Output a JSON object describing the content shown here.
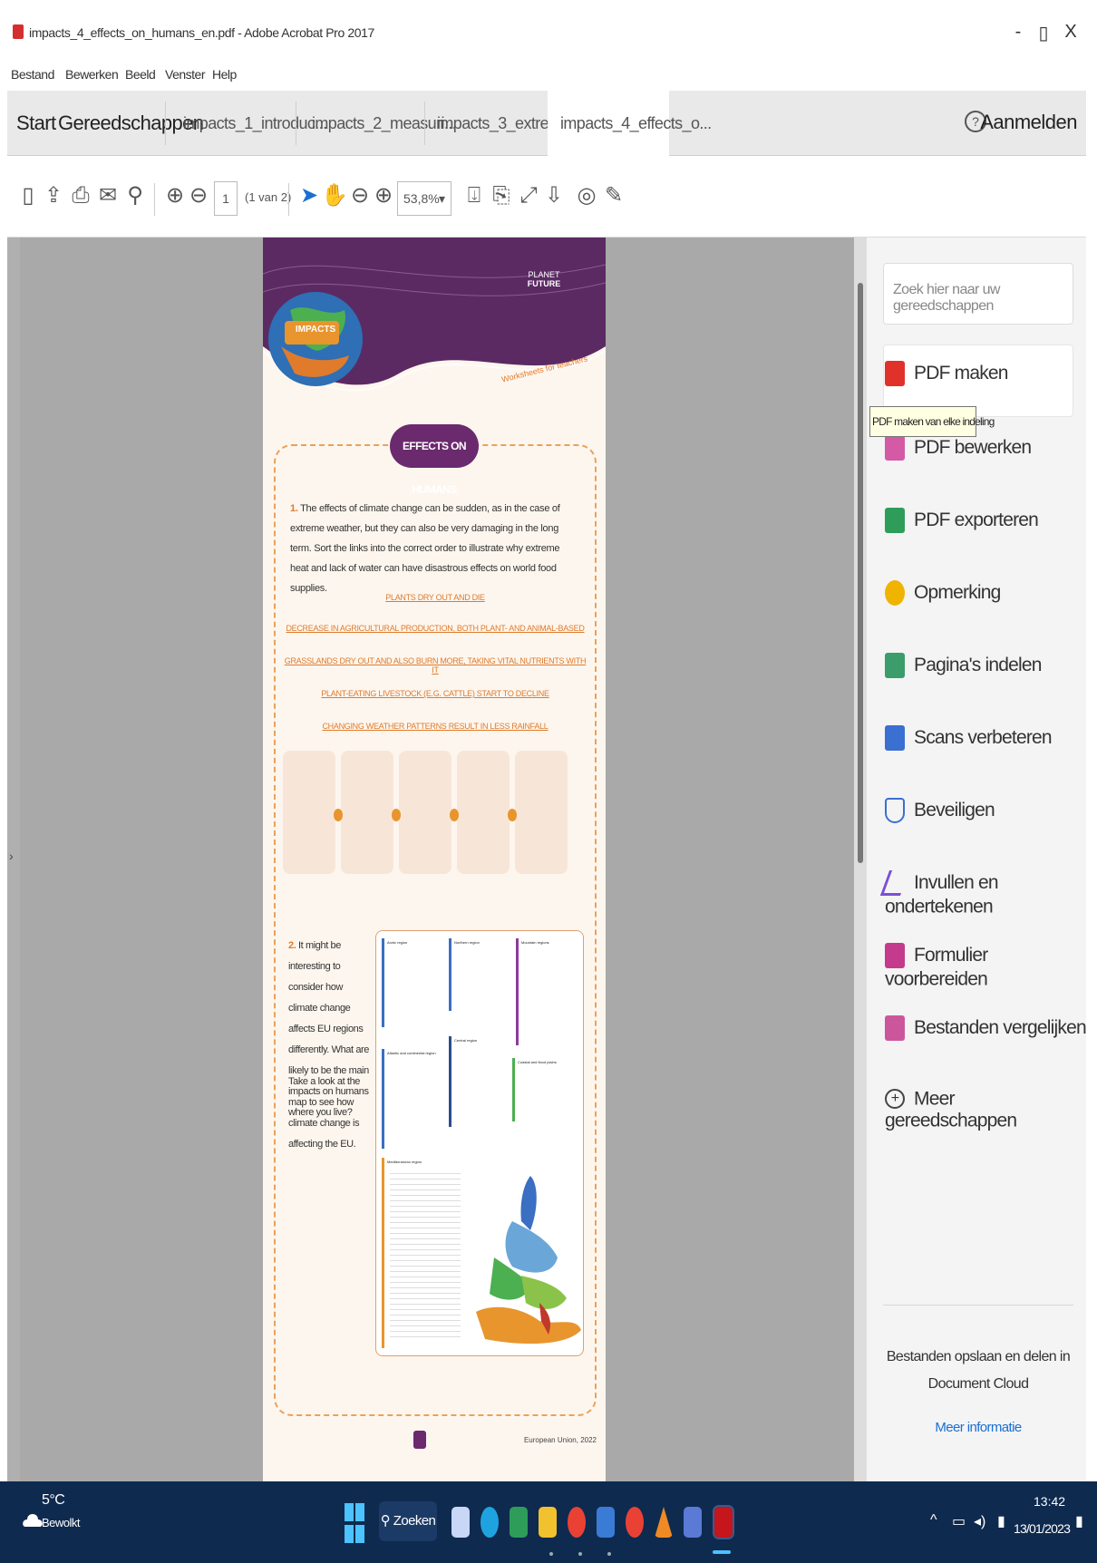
{
  "window": {
    "title": "impacts_4_effects_on_humans_en.pdf - Adobe Acrobat Pro 2017",
    "minimize": "-",
    "restore": "▯",
    "close": "X"
  },
  "menu": [
    "Bestand",
    "Bewerken",
    "Beeld",
    "Venster",
    "Help"
  ],
  "tabs": {
    "start": "Start",
    "tools": "Gereedschappen",
    "docs": [
      "impacts_1_introduc...",
      "impacts_2_measuri...",
      "impacts_3_extreme...",
      "impacts_4_effects_o..."
    ],
    "close_tab": "×",
    "help": "?",
    "login": "Aanmelden"
  },
  "toolbar": {
    "page_current": "1",
    "page_count": "(1 van 2)",
    "zoom": "53,8%",
    "zoom_caret": "▾"
  },
  "page": {
    "brand_line1": "PLANET",
    "brand_line2": "FUTURE",
    "impacts_label": "IMPACTS",
    "worksheets": "Worksheets for teachers",
    "section_title": "EFFECTS ON HUMANS",
    "q1_num": "1.",
    "q1_text": "The effects of climate change can be sudden, as in the case of extreme weather, but they can also be very damaging in the long term. Sort the links into the correct order to illustrate why extreme heat and lack of water can have disastrous effects on world food supplies.",
    "links": [
      "PLANTS DRY OUT AND DIE",
      "DECREASE IN AGRICULTURAL PRODUCTION, BOTH PLANT- AND ANIMAL-BASED",
      "GRASSLANDS DRY OUT AND ALSO BURN MORE, TAKING VITAL NUTRIENTS WITH IT",
      "PLANT-EATING LIVESTOCK (E.G. CATTLE) START TO DECLINE",
      "CHANGING WEATHER PATTERNS RESULT IN LESS RAINFALL"
    ],
    "q2_num": "2.",
    "q2_text": "It might be interesting to consider how climate change affects EU regions differently. What are likely to be the main impacts on humans where you live?",
    "q2_text_b": "Take a look at the map to see how climate change is affecting the EU.",
    "map_regions": [
      "Arctic region",
      "Northern region",
      "Mountain regions",
      "Atlantic and continental region",
      "Central region",
      "Coastal and flood plains",
      "Mediterranean region"
    ],
    "footer_note": "European Union, 2022"
  },
  "right_panel": {
    "search_placeholder": "Zoek hier naar uw gereedschappen",
    "tooltip": "PDF maken van elke indeling",
    "tools": [
      {
        "label": "PDF maken",
        "icon": "pdf-create-icon",
        "color": "#e0312b"
      },
      {
        "label": "PDF bewerken",
        "icon": "pdf-edit-icon",
        "color": "#d45aa6"
      },
      {
        "label": "PDF exporteren",
        "icon": "pdf-export-icon",
        "color": "#2e9d5a"
      },
      {
        "label": "Opmerking",
        "icon": "comment-icon",
        "color": "#f0b400"
      },
      {
        "label": "Pagina's indelen",
        "icon": "organize-pages-icon",
        "color": "#3a9d6b"
      },
      {
        "label": "Scans verbeteren",
        "icon": "enhance-scans-icon",
        "color": "#3b6fd1"
      },
      {
        "label": "Beveiligen",
        "icon": "protect-shield-icon",
        "color": "#3b6fd1"
      },
      {
        "label": "Invullen en ondertekenen",
        "icon": "fill-sign-icon",
        "color": "#7a4fd6"
      },
      {
        "label": "Formulier voorbereiden",
        "icon": "prepare-form-icon",
        "color": "#c43a8c"
      },
      {
        "label": "Bestanden vergelijken",
        "icon": "compare-files-icon",
        "color": "#c43a8c"
      },
      {
        "label": "Meer gereedschappen",
        "icon": "more-tools-icon",
        "color": "#444444"
      }
    ],
    "cloud_text": "Bestanden opslaan en delen in Document Cloud",
    "more_info": "Meer informatie"
  },
  "taskbar": {
    "temp": "5°C",
    "weather": "Bewolkt",
    "search": "Zoeken",
    "time": "13:42",
    "date": "13/01/2023"
  }
}
